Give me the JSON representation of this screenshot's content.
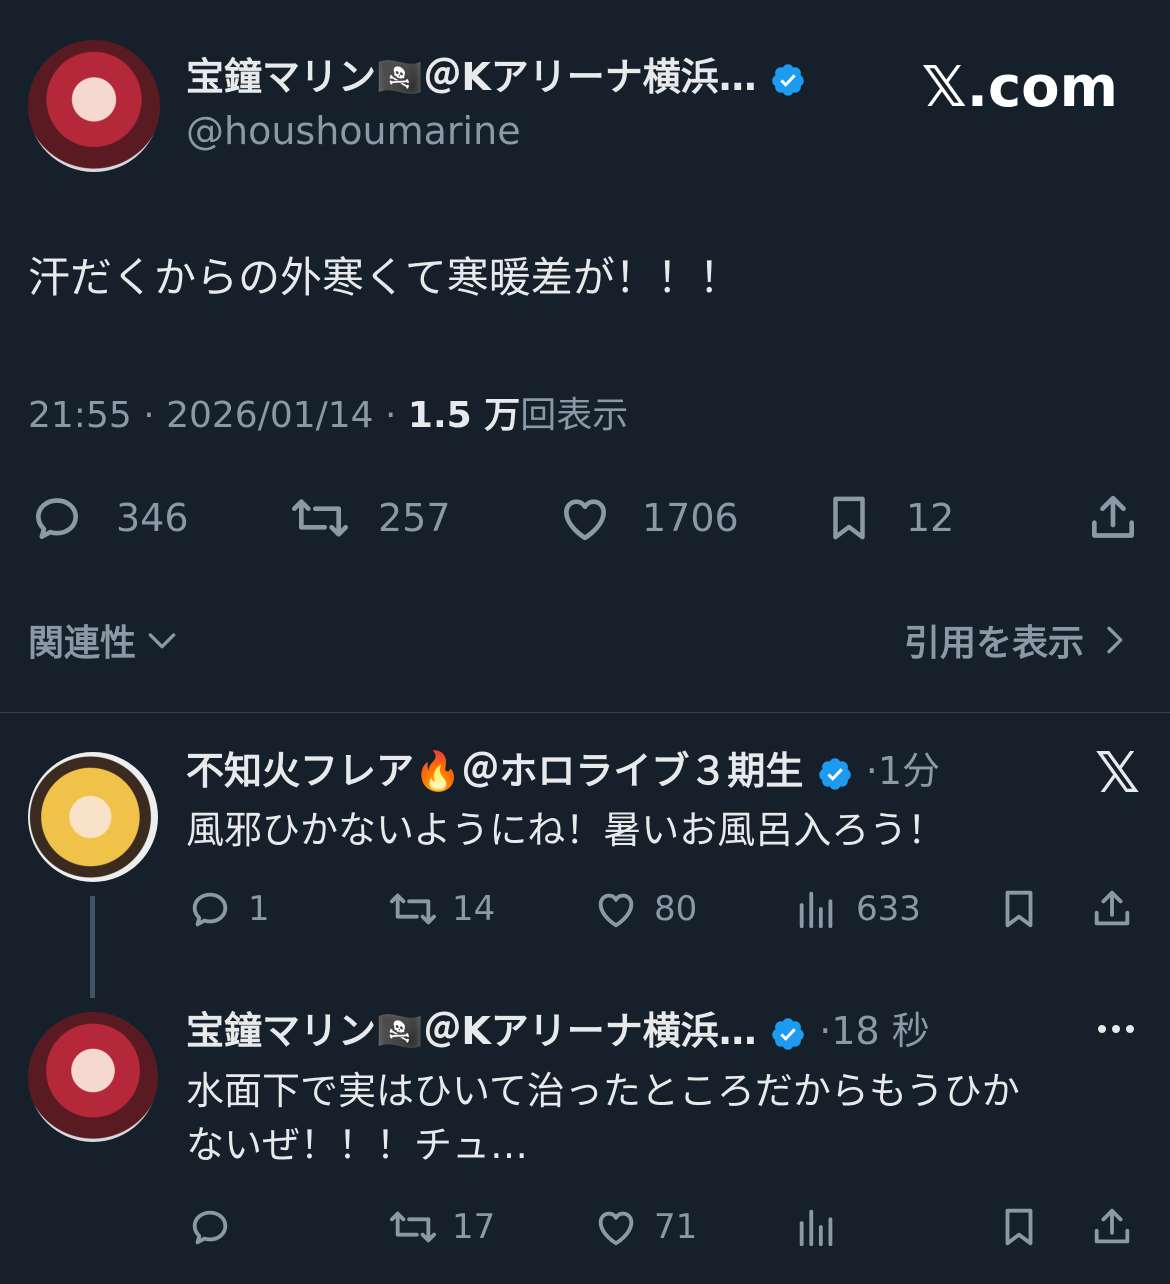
{
  "main_tweet": {
    "author_name": "宝鐘マリン🏴‍☠️＠Kアリーナ横浜…",
    "handle": "@houshoumarine",
    "site": "𝕏.com",
    "text": "汗だくからの外寒くて寒暖差が！！！",
    "time": "21:55 · 2026/01/14 ·",
    "views_count": "1.5 万",
    "views_label": "回表示",
    "replies": "346",
    "retweets": "257",
    "likes": "1706",
    "bookmarks": "12"
  },
  "filters": {
    "relevance": "関連性",
    "view_quotes": "引用を表示"
  },
  "reply1": {
    "author_name": "不知火フレア🔥＠ホロライブ３期生",
    "meta": "·1分",
    "text": "風邪ひかないようにね！暑いお風呂入ろう！",
    "replies": "1",
    "retweets": "14",
    "likes": "80",
    "views": "633"
  },
  "reply2": {
    "author_name": "宝鐘マリン🏴‍☠️＠Kアリーナ横浜…",
    "meta": "·18 秒",
    "text_line1": "水面下で実はひいて治ったところだからもうひか",
    "text_line2": "ないぜ！！！チュ…",
    "retweets": "17",
    "likes": "71"
  },
  "colors": {
    "background": "#15202b",
    "text": "#e7e9ea",
    "muted": "#8b98a5",
    "verified": "#1d9bf0"
  }
}
